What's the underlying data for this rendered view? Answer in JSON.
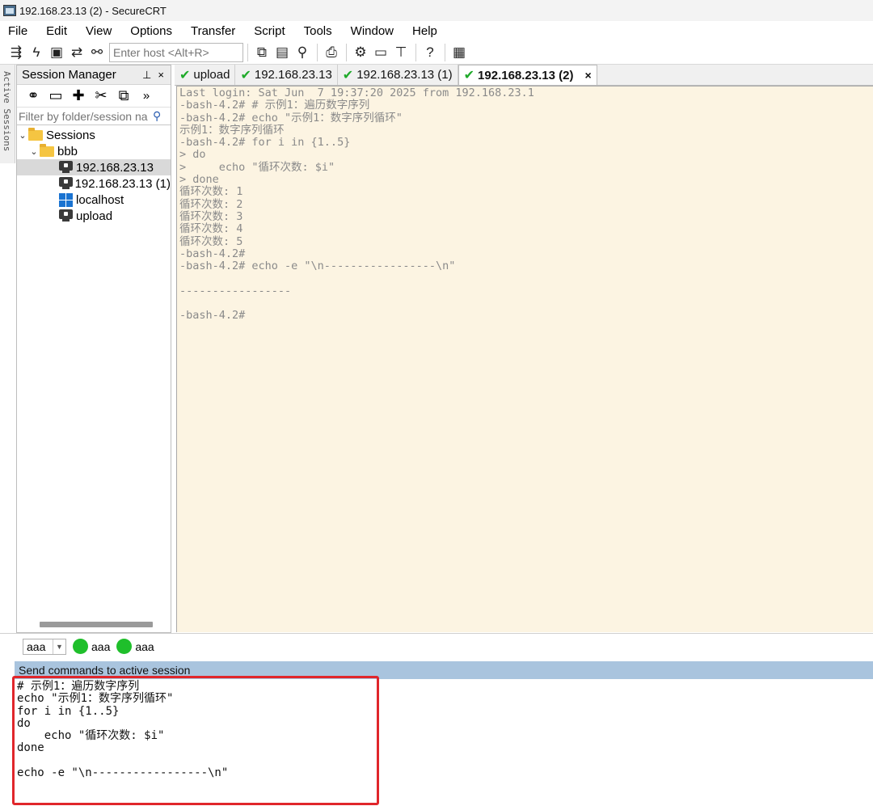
{
  "window": {
    "title": "192.168.23.13 (2) - SecureCRT"
  },
  "menu": [
    "File",
    "Edit",
    "View",
    "Options",
    "Transfer",
    "Script",
    "Tools",
    "Window",
    "Help"
  ],
  "toolbar": {
    "host_placeholder": "Enter host <Alt+R>",
    "icons": [
      "connect-icon",
      "quick-connect-icon",
      "connect-tab-icon",
      "reconnect-icon",
      "disconnect-icon",
      "copy-icon",
      "paste-icon",
      "find-icon",
      "print-icon",
      "settings-icon",
      "keymap-icon",
      "sftp-icon",
      "help-icon",
      "session-options-icon"
    ]
  },
  "vertical_strip": {
    "label": "Active Sessions"
  },
  "session_manager": {
    "title": "Session Manager",
    "pin_glyph": "⊥",
    "close_glyph": "×",
    "more_glyph": "»",
    "filter_placeholder": "Filter by folder/session na",
    "tree": [
      {
        "label": "Sessions",
        "type": "folder",
        "level": 0
      },
      {
        "label": "bbb",
        "type": "folder",
        "level": 1
      },
      {
        "label": "192.168.23.13",
        "type": "session",
        "level": 2,
        "selected": true
      },
      {
        "label": "192.168.23.13 (1)",
        "type": "session",
        "level": 2
      },
      {
        "label": "localhost",
        "type": "windows",
        "level": 2
      },
      {
        "label": "upload",
        "type": "session",
        "level": 2
      }
    ]
  },
  "tabs": [
    {
      "label": "upload",
      "active": false
    },
    {
      "label": "192.168.23.13",
      "active": false
    },
    {
      "label": "192.168.23.13 (1)",
      "active": false
    },
    {
      "label": "192.168.23.13 (2)",
      "active": true,
      "close": "×"
    }
  ],
  "terminal": {
    "background": "#fcf4e2",
    "text_color": "#8a8a8a",
    "lines": [
      "Last login: Sat Jun  7 19:37:20 2025 from 192.168.23.1",
      "-bash-4.2# # 示例1：遍历数字序列",
      "-bash-4.2# echo \"示例1：数字序列循环\"",
      "示例1：数字序列循环",
      "-bash-4.2# for i in {1..5}",
      "> do",
      ">     echo \"循环次数: $i\"",
      "> done",
      "循环次数: 1",
      "循环次数: 2",
      "循环次数: 3",
      "循环次数: 4",
      "循环次数: 5",
      "-bash-4.2#",
      "-bash-4.2# echo -e \"\\n-----------------\\n\"",
      "",
      "-----------------",
      "",
      "-bash-4.2#"
    ]
  },
  "button_bar": {
    "selector_value": "aaa",
    "buttons": [
      "aaa",
      "aaa"
    ]
  },
  "command_window": {
    "header": "Send commands to active session",
    "lines": [
      "# 示例1：遍历数字序列",
      "echo \"示例1：数字序列循环\"",
      "for i in {1..5}",
      "do",
      "    echo \"循环次数: $i\"",
      "done",
      "",
      "echo -e \"\\n-----------------\\n\""
    ]
  },
  "colors": {
    "highlight_border": "#e0262b",
    "command_header_bg": "#a9c4de",
    "check_green": "#1faa2a",
    "button_green": "#1fbf2b"
  }
}
